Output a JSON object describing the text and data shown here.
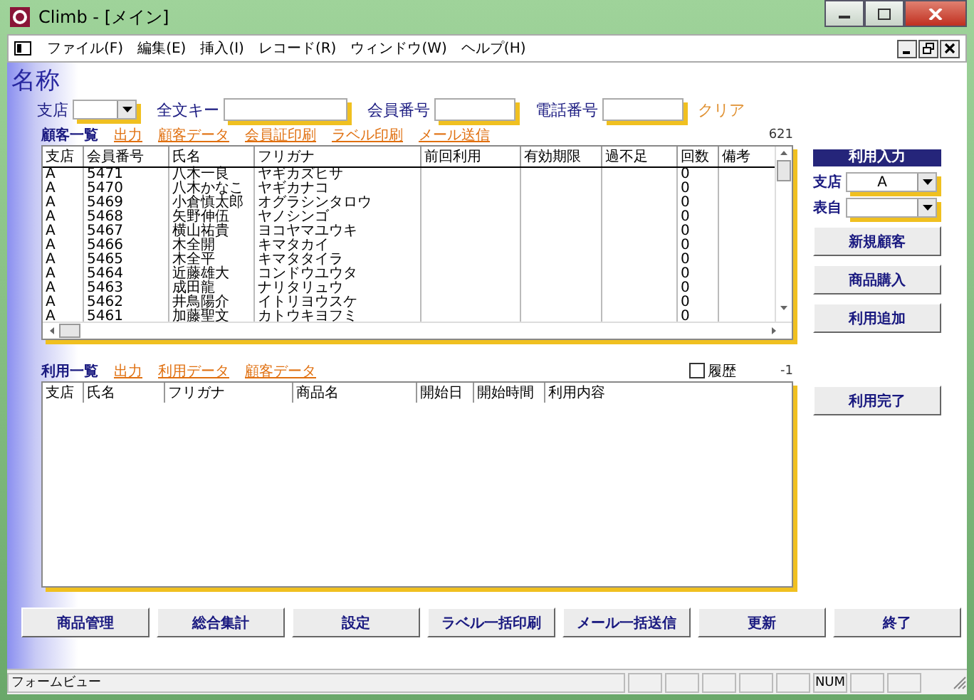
{
  "window": {
    "title": "Climb - [メイン]"
  },
  "menu": [
    "ファイル(F)",
    "編集(E)",
    "挿入(I)",
    "レコード(R)",
    "ウィンドウ(W)",
    "ヘルプ(H)"
  ],
  "form_title": "名称",
  "search": {
    "fields": [
      {
        "label": "支店",
        "kind": "combo"
      },
      {
        "label": "全文キー",
        "kind": "text"
      },
      {
        "label": "会員番号",
        "kind": "text"
      },
      {
        "label": "電話番号",
        "kind": "text"
      }
    ],
    "clear_link": "クリア"
  },
  "customers": {
    "title": "顧客一覧",
    "links": [
      "出力",
      "顧客データ",
      "会員証印刷",
      "ラベル印刷",
      "メール送信"
    ],
    "count": "621",
    "columns": [
      "支店",
      "会員番号",
      "氏名",
      "フリガナ",
      "前回利用",
      "有効期限",
      "過不足",
      "回数",
      "備考"
    ],
    "rows": [
      [
        "A",
        "5471",
        "八木一良",
        "ヤギカズヒサ",
        "",
        "",
        "",
        "0",
        ""
      ],
      [
        "A",
        "5470",
        "八木かなこ",
        "ヤギカナコ",
        "",
        "",
        "",
        "0",
        ""
      ],
      [
        "A",
        "5469",
        "小倉慎太郎",
        "オグラシンタロウ",
        "",
        "",
        "",
        "0",
        ""
      ],
      [
        "A",
        "5468",
        "矢野伸伍",
        "ヤノシンゴ",
        "",
        "",
        "",
        "0",
        ""
      ],
      [
        "A",
        "5467",
        "横山祐貴",
        "ヨコヤマユウキ",
        "",
        "",
        "",
        "0",
        ""
      ],
      [
        "A",
        "5466",
        "木全開",
        "キマタカイ",
        "",
        "",
        "",
        "0",
        ""
      ],
      [
        "A",
        "5465",
        "木全平",
        "キマタタイラ",
        "",
        "",
        "",
        "0",
        ""
      ],
      [
        "A",
        "5464",
        "近藤雄大",
        "コンドウユウタ",
        "",
        "",
        "",
        "0",
        ""
      ],
      [
        "A",
        "5463",
        "成田龍",
        "ナリタリュウ",
        "",
        "",
        "",
        "0",
        ""
      ],
      [
        "A",
        "5462",
        "井鳥陽介",
        "イトリヨウスケ",
        "",
        "",
        "",
        "0",
        ""
      ],
      [
        "A",
        "5461",
        "加藤聖文",
        "カトウキヨフミ",
        "",
        "",
        "",
        "0",
        ""
      ]
    ]
  },
  "usage_input": {
    "title": "利用入力",
    "fields": [
      {
        "label": "支店",
        "value": "A"
      },
      {
        "label": "表自"
      }
    ],
    "buttons": [
      "新規顧客",
      "商品購入",
      "利用追加"
    ]
  },
  "usage": {
    "title": "利用一覧",
    "links": [
      "出力",
      "利用データ",
      "顧客データ"
    ],
    "history": {
      "label": "履歴",
      "checked": false
    },
    "count": "-1",
    "columns": [
      "支店",
      "氏名",
      "フリガナ",
      "商品名",
      "開始日",
      "開始時間",
      "利用内容"
    ],
    "button": "利用完了"
  },
  "bottom_buttons": [
    "商品管理",
    "総合集計",
    "設定",
    "ラベル一括印刷",
    "メール一括送信",
    "更新",
    "終了"
  ],
  "status_bar": {
    "text": "フォームビュー",
    "num_indicator": "NUM"
  }
}
